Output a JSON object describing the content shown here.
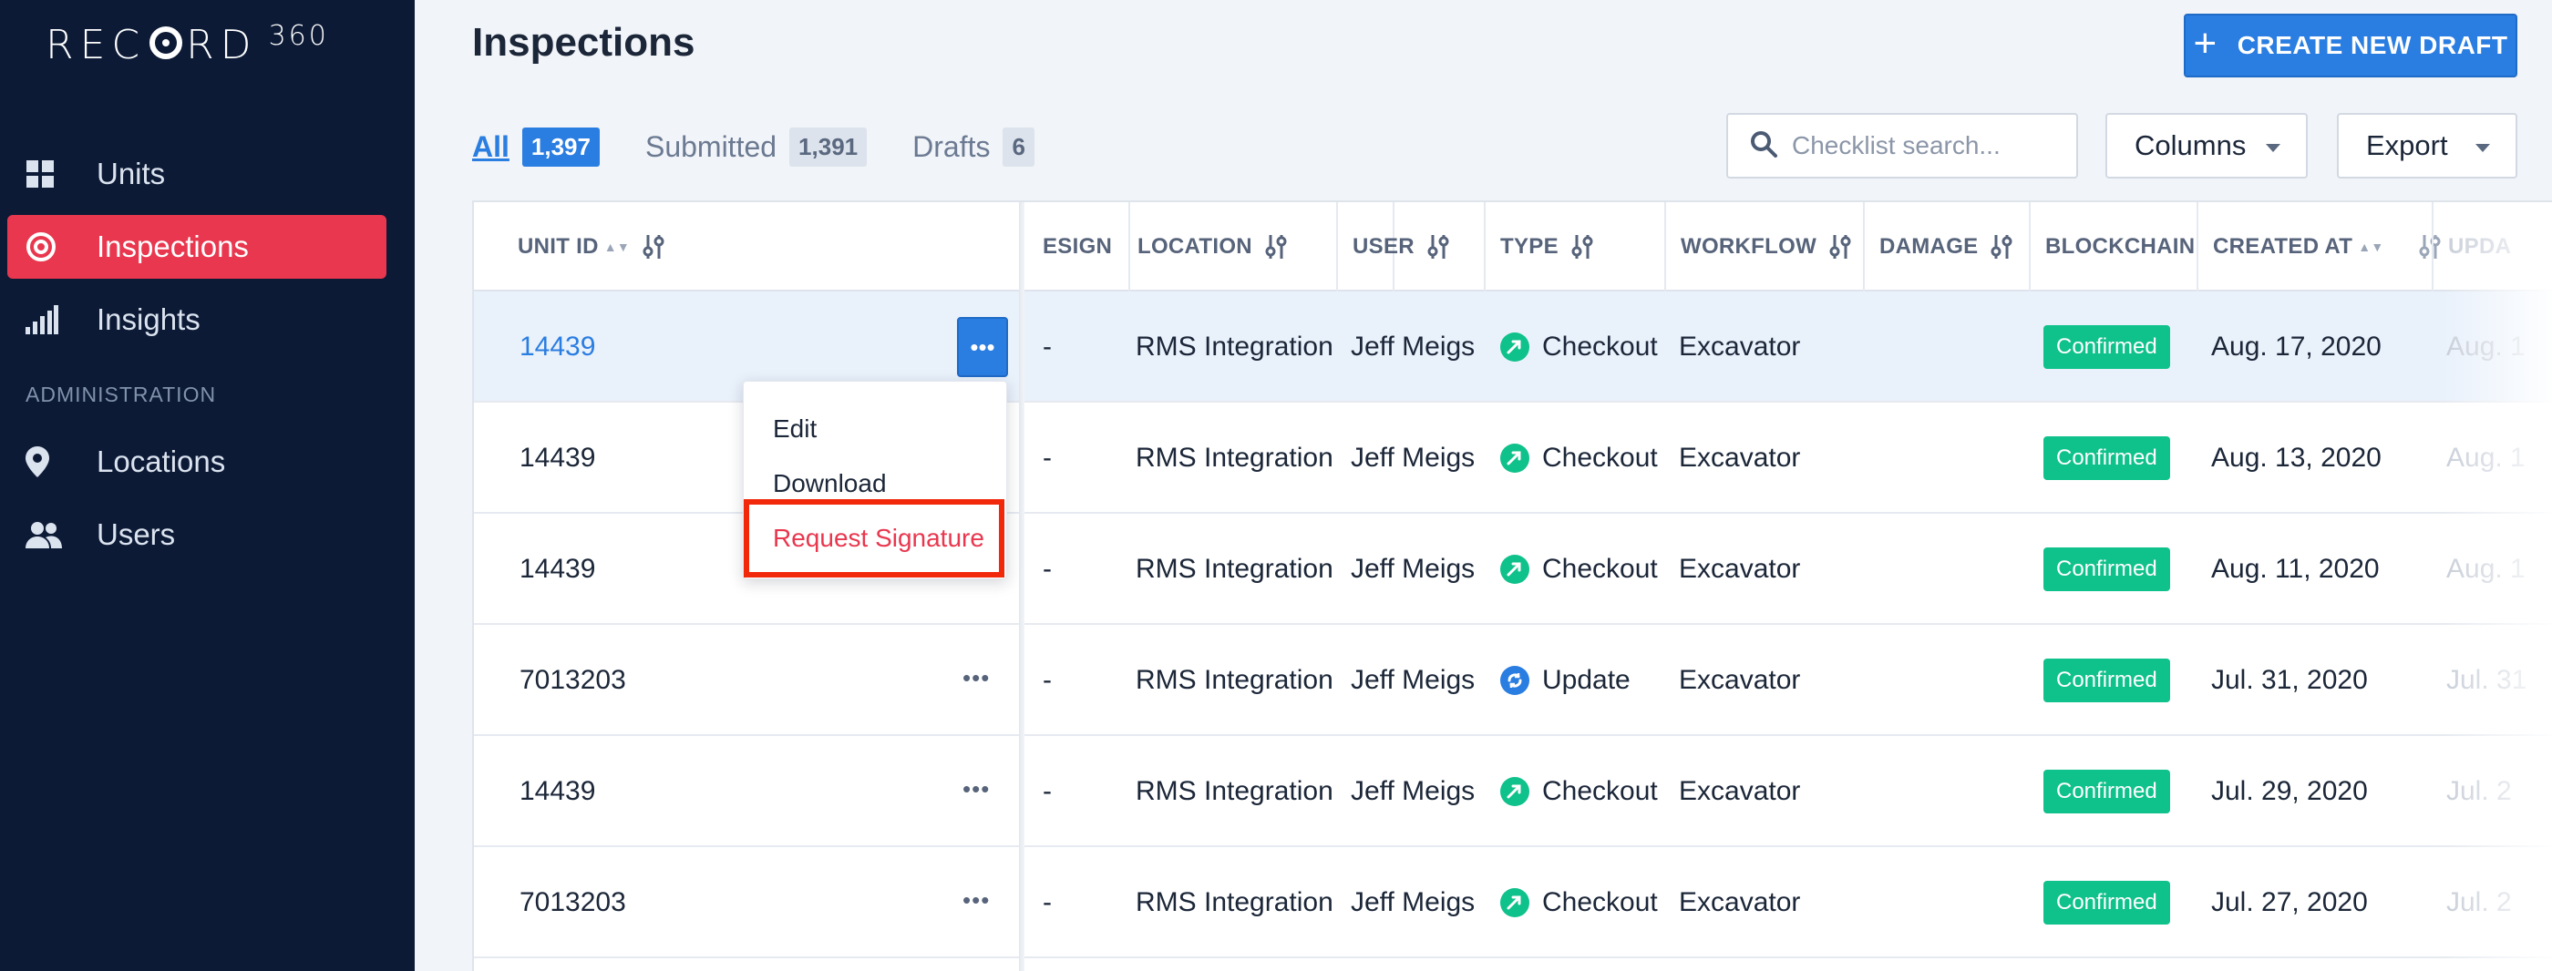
{
  "app": {
    "logo_text": "REC",
    "logo_text_2": "RD",
    "logo_sup": "360"
  },
  "sidebar": {
    "items": [
      {
        "label": "Units",
        "icon": "grid-icon"
      },
      {
        "label": "Inspections",
        "icon": "target-icon",
        "active": true
      },
      {
        "label": "Insights",
        "icon": "bars-icon"
      }
    ],
    "section_label": "ADMINISTRATION",
    "admin_items": [
      {
        "label": "Locations",
        "icon": "pin-icon"
      },
      {
        "label": "Users",
        "icon": "users-icon"
      }
    ]
  },
  "header": {
    "title": "Inspections",
    "create_label": "CREATE NEW DRAFT"
  },
  "tabs": [
    {
      "label": "All",
      "count": "1,397",
      "active": true
    },
    {
      "label": "Submitted",
      "count": "1,391"
    },
    {
      "label": "Drafts",
      "count": "6"
    }
  ],
  "search": {
    "placeholder": "Checklist search..."
  },
  "columns_button": "Columns",
  "export_button": "Export",
  "table": {
    "headers": [
      "UNIT ID",
      "ESIGN",
      "LOCATION",
      "USER",
      "TYPE",
      "WORKFLOW",
      "DAMAGE",
      "BLOCKCHAIN",
      "CREATED AT",
      "UPDA"
    ],
    "rows": [
      {
        "unit": "14439",
        "esign": "-",
        "location": "RMS Integration",
        "user": "Jeff Meigs",
        "type": "Checkout",
        "workflow": "Excavator",
        "blockchain": "Confirmed",
        "created": "Aug. 17, 2020",
        "updated": "Aug. 1"
      },
      {
        "unit": "14439",
        "esign": "-",
        "location": "RMS Integration",
        "user": "Jeff Meigs",
        "type": "Checkout",
        "workflow": "Excavator",
        "blockchain": "Confirmed",
        "created": "Aug. 13, 2020",
        "updated": "Aug. 1"
      },
      {
        "unit": "14439",
        "esign": "-",
        "location": "RMS Integration",
        "user": "Jeff Meigs",
        "type": "Checkout",
        "workflow": "Excavator",
        "blockchain": "Confirmed",
        "created": "Aug. 11, 2020",
        "updated": "Aug. 1"
      },
      {
        "unit": "7013203",
        "esign": "-",
        "location": "RMS Integration",
        "user": "Jeff Meigs",
        "type": "Update",
        "workflow": "Excavator",
        "blockchain": "Confirmed",
        "created": "Jul. 31, 2020",
        "updated": "Jul. 31"
      },
      {
        "unit": "14439",
        "esign": "-",
        "location": "RMS Integration",
        "user": "Jeff Meigs",
        "type": "Checkout",
        "workflow": "Excavator",
        "blockchain": "Confirmed",
        "created": "Jul. 29, 2020",
        "updated": "Jul. 2"
      },
      {
        "unit": "7013203",
        "esign": "-",
        "location": "RMS Integration",
        "user": "Jeff Meigs",
        "type": "Checkout",
        "workflow": "Excavator",
        "blockchain": "Confirmed",
        "created": "Jul. 27, 2020",
        "updated": "Jul. 2"
      }
    ]
  },
  "context_menu": {
    "items": [
      "Edit",
      "Download",
      "Request Signature"
    ]
  },
  "colors": {
    "sidebar_bg": "#0c1a36",
    "accent": "#2a7de1",
    "active_nav": "#e8374e",
    "confirmed": "#0fc18a",
    "checkout": "#0fc18a",
    "update": "#2a7de1",
    "highlight": "#f2280b"
  }
}
